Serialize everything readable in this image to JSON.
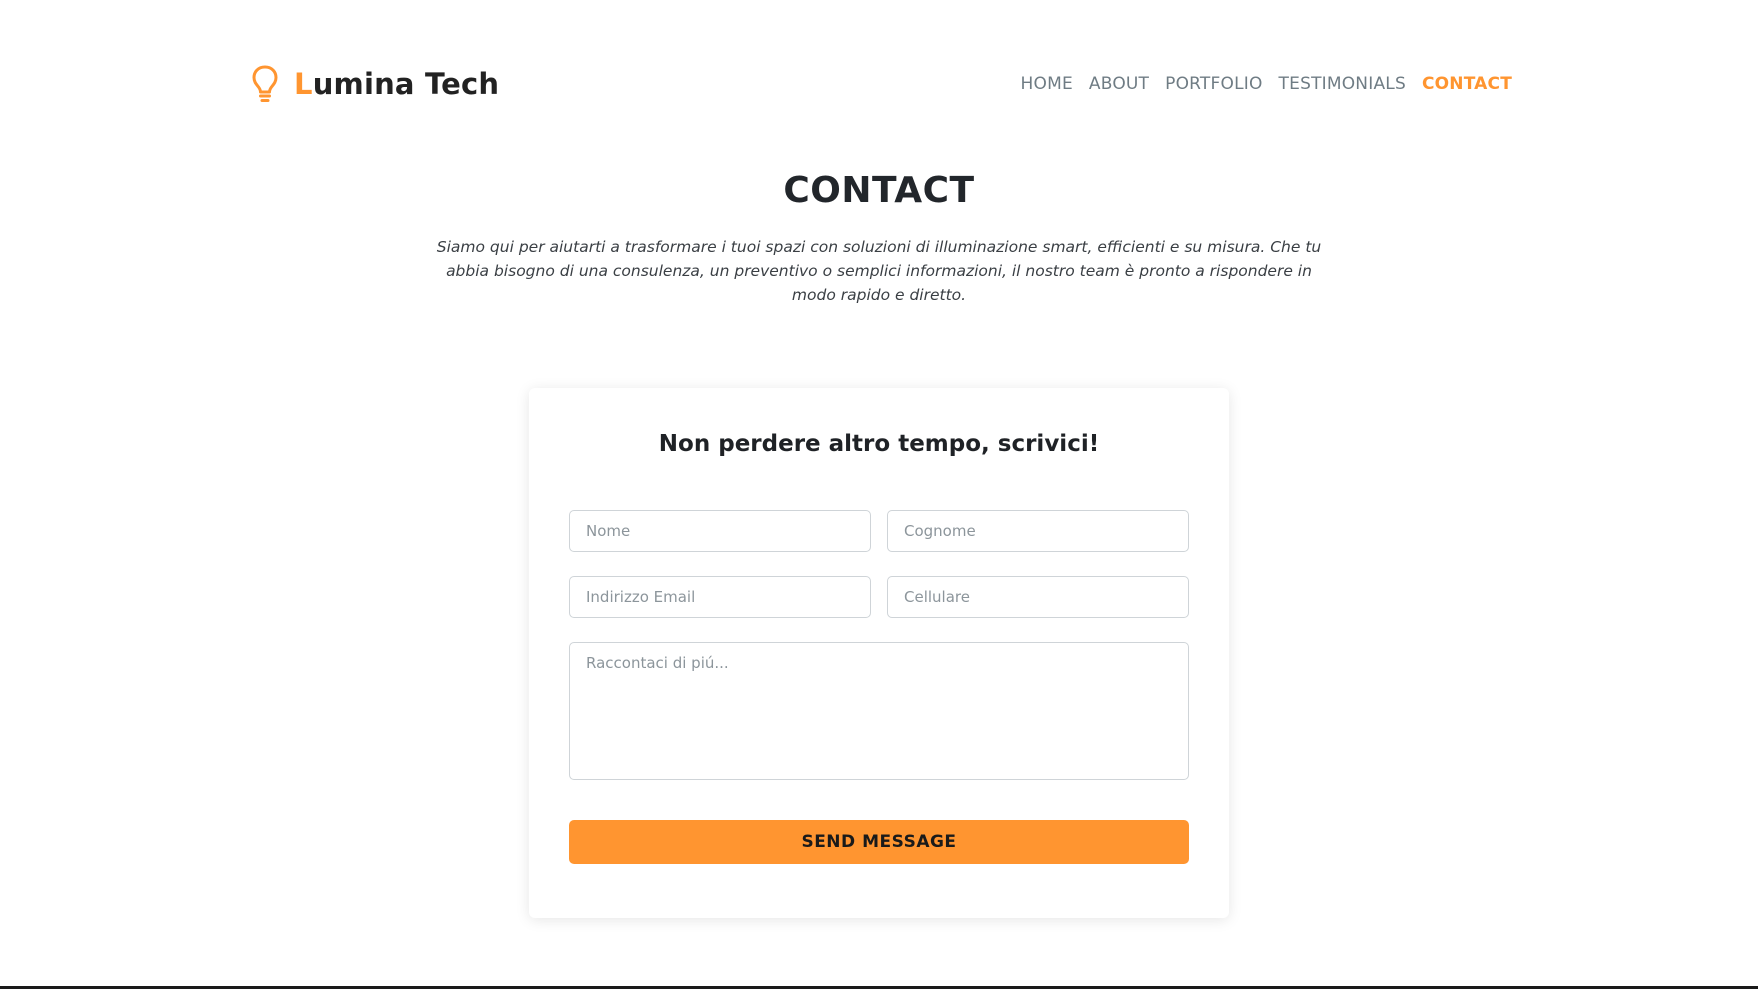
{
  "brand": {
    "first_letter": "L",
    "rest": "umina Tech",
    "icon": "lightbulb-icon",
    "accent_color": "#ff9530"
  },
  "nav": {
    "items": [
      {
        "label": "HOME"
      },
      {
        "label": "ABOUT"
      },
      {
        "label": "PORTFOLIO"
      },
      {
        "label": "TESTIMONIALS"
      },
      {
        "label": "CONTACT",
        "active": true
      }
    ]
  },
  "hero": {
    "title": "CONTACT",
    "text": "Siamo qui per aiutarti a trasformare i tuoi spazi con soluzioni di illuminazione smart, efficienti e su misura. Che tu abbia bisogno di una consulenza, un preventivo o semplici informazioni, il nostro team è pronto a rispondere in modo rapido e diretto."
  },
  "form": {
    "title": "Non perdere altro tempo, scrivici!",
    "first_name": {
      "placeholder": "Nome",
      "value": ""
    },
    "last_name": {
      "placeholder": "Cognome",
      "value": ""
    },
    "email": {
      "placeholder": "Indirizzo Email",
      "value": ""
    },
    "phone": {
      "placeholder": "Cellulare",
      "value": ""
    },
    "message": {
      "placeholder": "Raccontaci di piú...",
      "value": ""
    },
    "submit_label": "SEND MESSAGE"
  }
}
